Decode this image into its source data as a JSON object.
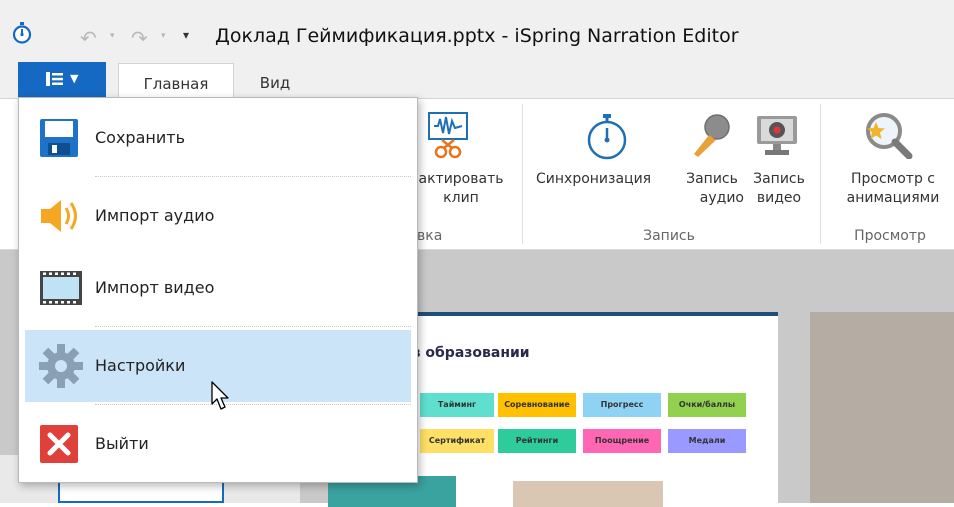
{
  "window": {
    "title": "Доклад Геймификация.pptx - iSpring Narration Editor"
  },
  "ribbon": {
    "tabs": [
      {
        "label": "Главная",
        "active": true
      },
      {
        "label": "Вид",
        "active": false
      }
    ],
    "edit_group": {
      "trim_line1": "актировать",
      "trim_line2": "клип",
      "name_partial": "вка"
    },
    "record_group": {
      "sync_label": "Синхронизация",
      "audio_line1": "Запись",
      "audio_line2": "аудио",
      "video_line1": "Запись",
      "video_line2": "видео",
      "name": "Запись"
    },
    "preview_group": {
      "preview_line1": "Просмотр с",
      "preview_line2": "анимациями",
      "name": "Просмотр"
    }
  },
  "file_menu": {
    "items": [
      {
        "label": "Сохранить",
        "icon": "save-icon"
      },
      {
        "label": "Импорт аудио",
        "icon": "speaker-icon"
      },
      {
        "label": "Импорт видео",
        "icon": "film-icon"
      },
      {
        "label": "Настройки",
        "icon": "gear-icon",
        "highlighted": true
      },
      {
        "label": "Выйти",
        "icon": "close-icon"
      }
    ]
  },
  "slide": {
    "title_partial": "ия в образовании",
    "row1": [
      {
        "label": "Тайминг",
        "color": "#5fe0cf"
      },
      {
        "label": "Соревнование",
        "color": "#ffc000"
      },
      {
        "label": "Прогресс",
        "color": "#8fd3f4"
      },
      {
        "label": "Очки/баллы",
        "color": "#92d050"
      }
    ],
    "row2": [
      {
        "label": "Сертификат",
        "color": "#ffe066"
      },
      {
        "label": "Рейтинги",
        "color": "#2ecc9a"
      },
      {
        "label": "Поощрение",
        "color": "#ff66b3"
      },
      {
        "label": "Медали",
        "color": "#9999ff"
      }
    ]
  },
  "colors": {
    "accent": "#1669c2",
    "menu_highlight": "#cce4f7"
  }
}
